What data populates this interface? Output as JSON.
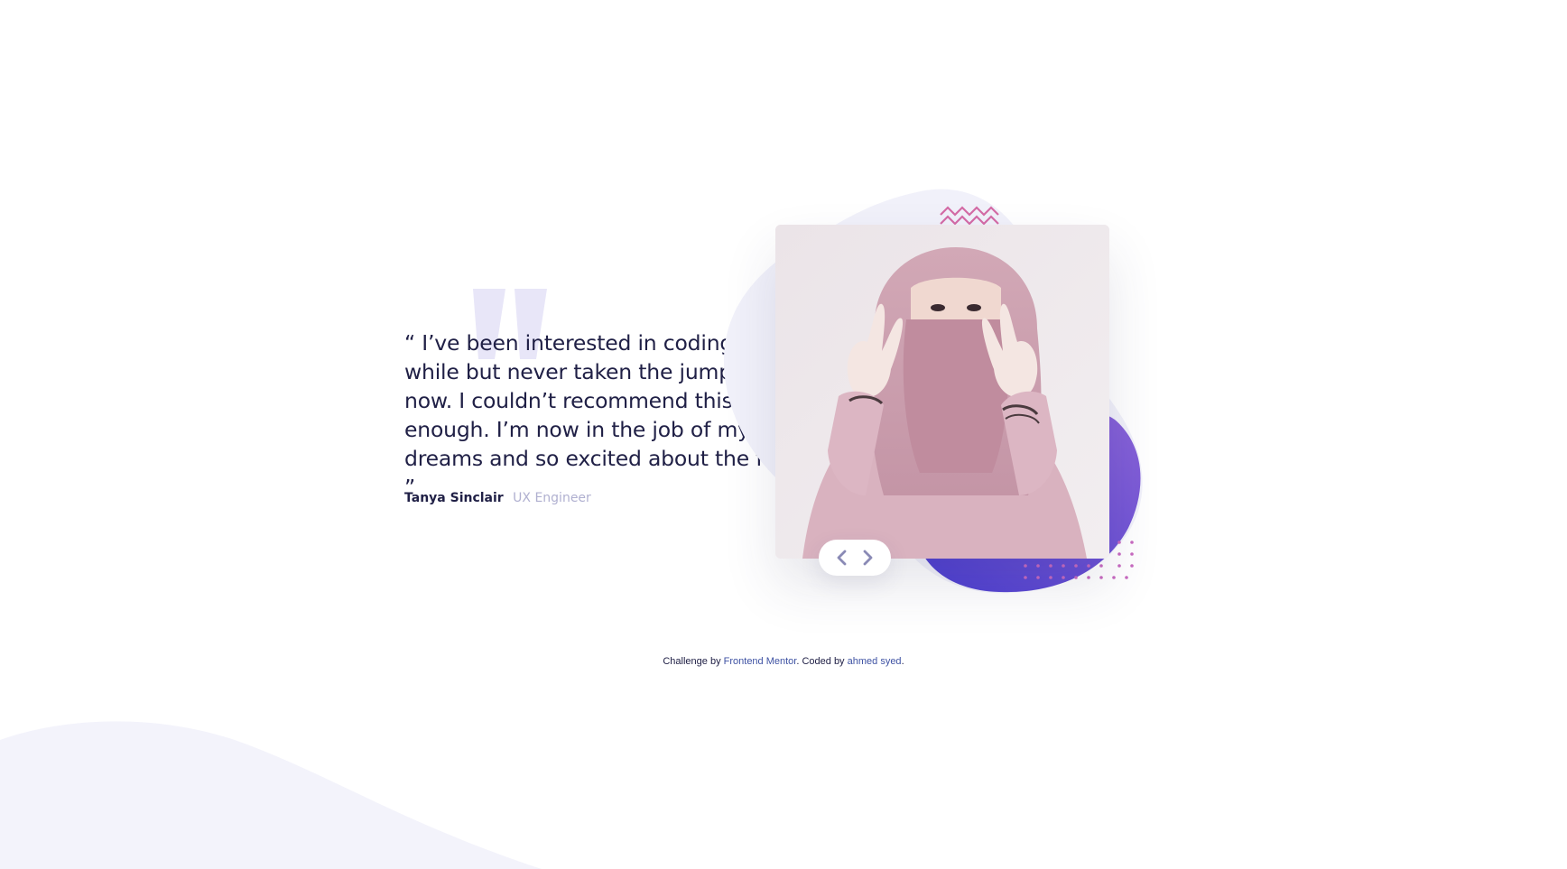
{
  "testimonial": {
    "quote": "“ I’ve been interested in coding for a while but never taken the jump, until now. I couldn’t recommend this course enough. I’m now in the job of my dreams and so excited about the future. ”",
    "name": "Tanya Sinclair",
    "role": "UX Engineer"
  },
  "photo": {
    "icon": "portrait-photo"
  },
  "navigation": {
    "prev_icon": "chevron-left-icon",
    "next_icon": "chevron-right-icon"
  },
  "footer": {
    "prefix": "Challenge by ",
    "challenge_link": "Frontend Mentor",
    "middle": ". Coded by ",
    "author_link": "ahmed syed",
    "suffix": "."
  },
  "colors": {
    "text_dark": "#202046",
    "text_muted": "#b0b0d0",
    "accent_purple": "#5a3fd0",
    "accent_pink": "#d46ba6",
    "bg_soft": "#f3f3fb"
  }
}
